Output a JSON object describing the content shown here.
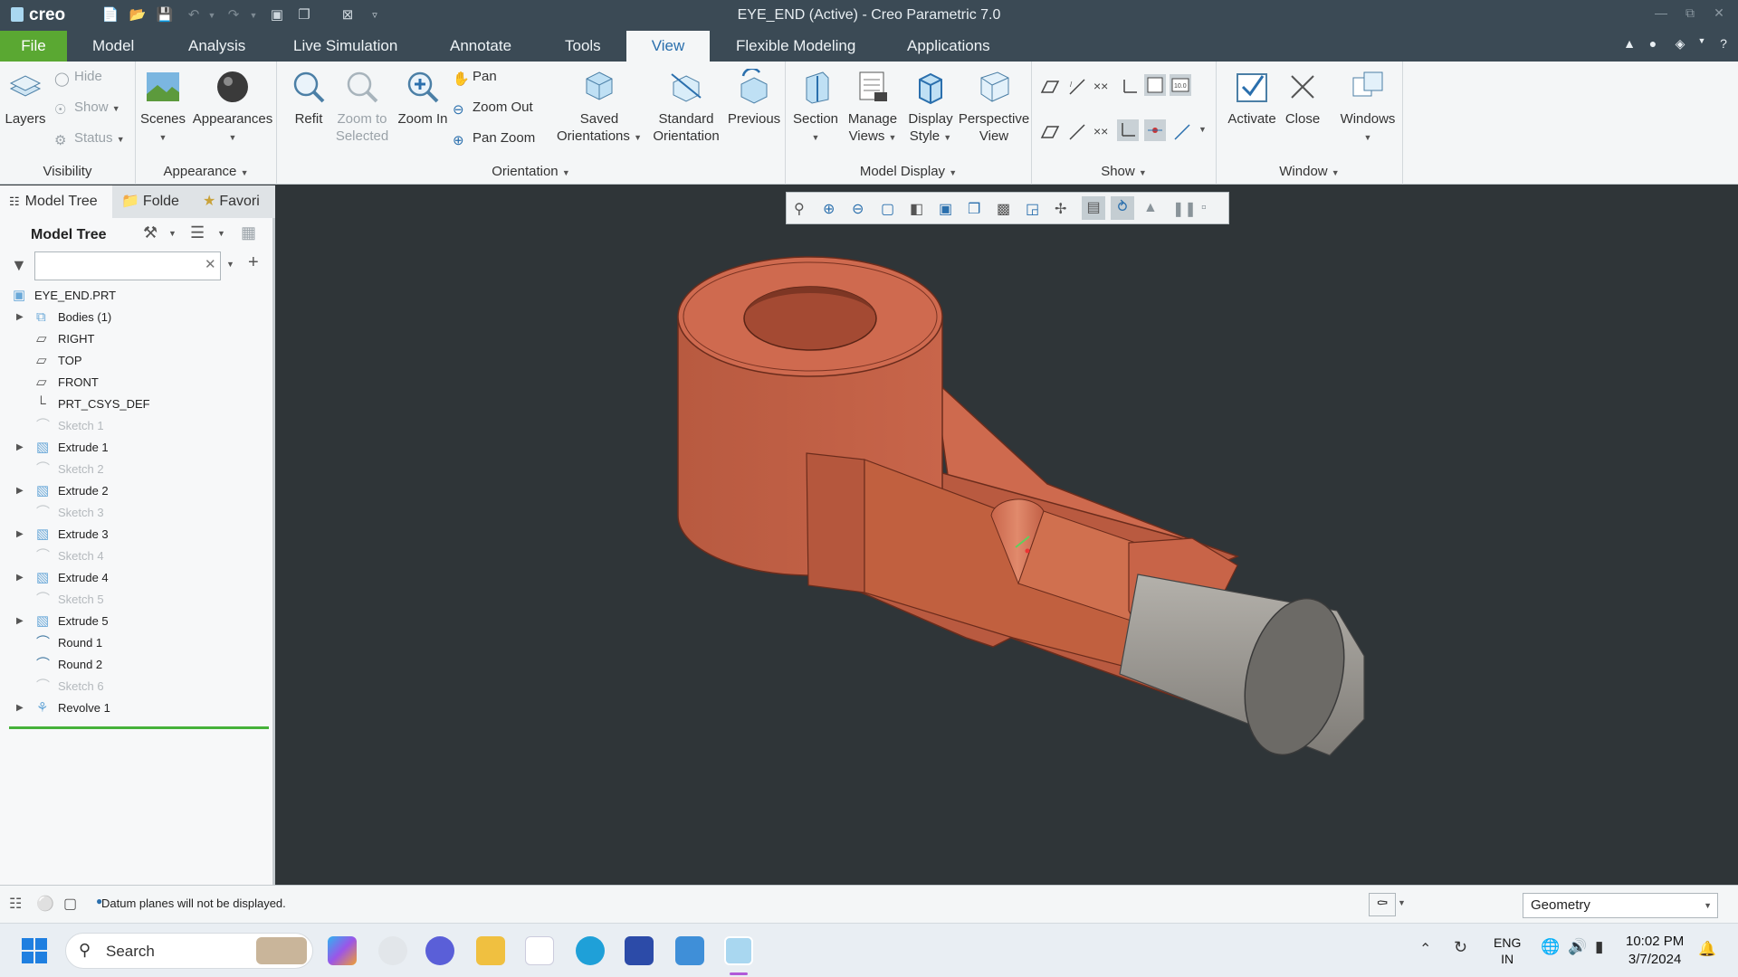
{
  "app": {
    "logo": "creo",
    "window_title": "EYE_END (Active) - Creo Parametric 7.0"
  },
  "ribbon_tabs": {
    "file": "File",
    "model": "Model",
    "analysis": "Analysis",
    "live_simulation": "Live Simulation",
    "annotate": "Annotate",
    "tools": "Tools",
    "view": "View",
    "flexible_modeling": "Flexible Modeling",
    "applications": "Applications",
    "active": "View"
  },
  "ribbon": {
    "visibility": {
      "group": "Visibility",
      "layers": "Layers",
      "hide": "Hide",
      "show": "Show",
      "status": "Status"
    },
    "appearance": {
      "group": "Appearance",
      "scenes": "Scenes",
      "appearances": "Appearances"
    },
    "orientation": {
      "group": "Orientation",
      "refit": "Refit",
      "zoom_to_selected_1": "Zoom to",
      "zoom_to_selected_2": "Selected",
      "zoom_in": "Zoom In",
      "pan": "Pan",
      "zoom_out": "Zoom Out",
      "pan_zoom": "Pan Zoom",
      "saved_1": "Saved",
      "saved_2": "Orientations",
      "standard_1": "Standard",
      "standard_2": "Orientation",
      "previous": "Previous"
    },
    "model_display": {
      "group": "Model Display",
      "section": "Section",
      "manage_1": "Manage",
      "manage_2": "Views",
      "display_1": "Display",
      "display_2": "Style",
      "perspective_1": "Perspective",
      "perspective_2": "View"
    },
    "show": {
      "group": "Show"
    },
    "window": {
      "group": "Window",
      "activate": "Activate",
      "close": "Close",
      "windows": "Windows"
    }
  },
  "left_panel": {
    "tabs": {
      "model_tree": "Model Tree",
      "folder": "Folde",
      "favorites": "Favori"
    },
    "header": "Model Tree",
    "filter_placeholder": "",
    "items": [
      {
        "label": "EYE_END.PRT",
        "type": "part",
        "expandable": false,
        "dim": false,
        "indent": 0
      },
      {
        "label": "Bodies (1)",
        "type": "bodies",
        "expandable": true,
        "dim": false,
        "indent": 1
      },
      {
        "label": "RIGHT",
        "type": "plane",
        "expandable": false,
        "dim": false,
        "indent": 1
      },
      {
        "label": "TOP",
        "type": "plane",
        "expandable": false,
        "dim": false,
        "indent": 1
      },
      {
        "label": "FRONT",
        "type": "plane",
        "expandable": false,
        "dim": false,
        "indent": 1
      },
      {
        "label": "PRT_CSYS_DEF",
        "type": "csys",
        "expandable": false,
        "dim": false,
        "indent": 1
      },
      {
        "label": "Sketch 1",
        "type": "sketch",
        "expandable": false,
        "dim": true,
        "indent": 1
      },
      {
        "label": "Extrude 1",
        "type": "extrude",
        "expandable": true,
        "dim": false,
        "indent": 1
      },
      {
        "label": "Sketch 2",
        "type": "sketch",
        "expandable": false,
        "dim": true,
        "indent": 1
      },
      {
        "label": "Extrude 2",
        "type": "extrude",
        "expandable": true,
        "dim": false,
        "indent": 1
      },
      {
        "label": "Sketch 3",
        "type": "sketch",
        "expandable": false,
        "dim": true,
        "indent": 1
      },
      {
        "label": "Extrude 3",
        "type": "extrude",
        "expandable": true,
        "dim": false,
        "indent": 1
      },
      {
        "label": "Sketch 4",
        "type": "sketch",
        "expandable": false,
        "dim": true,
        "indent": 1
      },
      {
        "label": "Extrude 4",
        "type": "extrude",
        "expandable": true,
        "dim": false,
        "indent": 1
      },
      {
        "label": "Sketch 5",
        "type": "sketch",
        "expandable": false,
        "dim": true,
        "indent": 1
      },
      {
        "label": "Extrude 5",
        "type": "extrude",
        "expandable": true,
        "dim": false,
        "indent": 1
      },
      {
        "label": "Round 1",
        "type": "round",
        "expandable": false,
        "dim": false,
        "indent": 1
      },
      {
        "label": "Round 2",
        "type": "round",
        "expandable": false,
        "dim": false,
        "indent": 1
      },
      {
        "label": "Sketch 6",
        "type": "sketch",
        "expandable": false,
        "dim": true,
        "indent": 1
      },
      {
        "label": "Revolve 1",
        "type": "revolve",
        "expandable": true,
        "dim": false,
        "indent": 1
      }
    ]
  },
  "status_bar": {
    "message": "Datum planes will not be displayed.",
    "selection_filter": "Geometry"
  },
  "taskbar": {
    "search": "Search",
    "lang_1": "ENG",
    "lang_2": "IN",
    "time": "10:02 PM",
    "date": "3/7/2024"
  },
  "colors": {
    "titlebar": "#3b4a55",
    "file_tab": "#5aa832",
    "active_tab_text": "#2a6fad",
    "viewport_bg": "#2f3538",
    "part_body": "#c8654a",
    "part_shaft": "#9a9792"
  }
}
